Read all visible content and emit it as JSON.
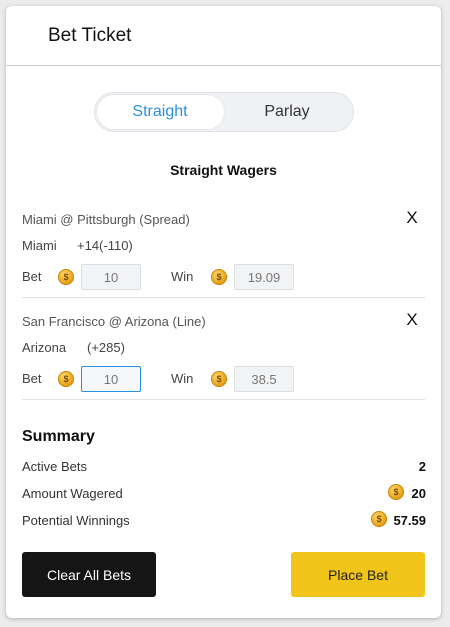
{
  "header": {
    "title": "Bet Ticket"
  },
  "toggle": {
    "options": [
      "Straight",
      "Parlay"
    ],
    "active": "Straight"
  },
  "section_heading": "Straight Wagers",
  "wagers": [
    {
      "title": "Miami @ Pittsburgh (Spread)",
      "team": "Miami",
      "odds": "+14(-110)",
      "bet_label": "Bet",
      "bet_value": "10",
      "win_label": "Win",
      "win_value": "19.09",
      "remove": "X"
    },
    {
      "title": "San Francisco @ Arizona (Line)",
      "team": "Arizona",
      "odds": "(+285)",
      "bet_label": "Bet",
      "bet_value": "10",
      "win_label": "Win",
      "win_value": "38.5",
      "remove": "X"
    }
  ],
  "summary": {
    "title": "Summary",
    "active_bets_label": "Active Bets",
    "active_bets_value": "2",
    "amount_label": "Amount Wagered",
    "amount_value": "20",
    "winnings_label": "Potential Winnings",
    "winnings_value": "57.59"
  },
  "buttons": {
    "clear": "Clear All Bets",
    "place": "Place Bet"
  },
  "colors": {
    "accent": "#2b8fe0",
    "place_button": "#f0c419",
    "clear_button": "#151515",
    "coin": "#e8a41a"
  }
}
